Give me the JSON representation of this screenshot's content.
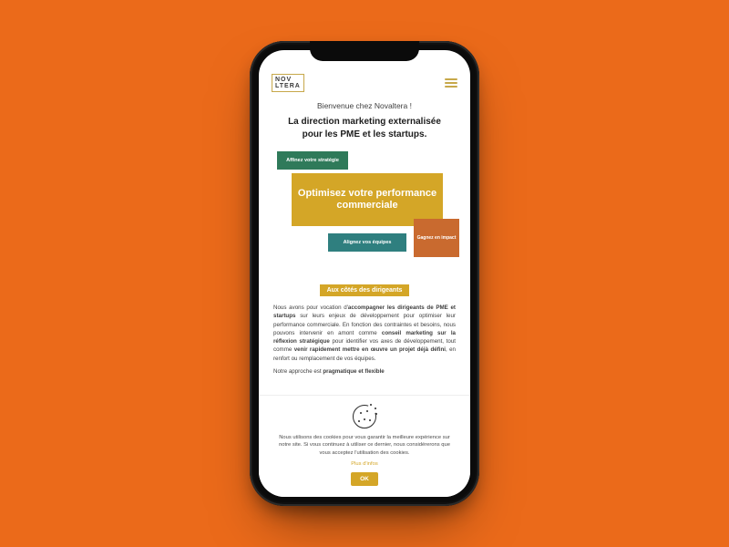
{
  "header": {
    "logo_line1": "NOV",
    "logo_line2": "LTERA"
  },
  "hero": {
    "welcome": "Bienvenue chez Novaltera !",
    "headline_l1": "La direction marketing externalisée",
    "headline_l2": "pour les PME et les startups."
  },
  "boxes": {
    "green": "Affinez votre stratégie",
    "yellow_l1": "Optimisez votre performance",
    "yellow_l2": "commerciale",
    "orange": "Gagnez en impact",
    "teal": "Alignez vos équipes"
  },
  "chip": "Aux côtés des dirigeants",
  "para1": {
    "t1": "Nous avons pour vocation d'",
    "b1": "accompagner les dirigeants de PME et startups",
    "t2": " sur leurs enjeux de développement pour optimiser leur performance commerciale. En fonction des contraintes et besoins, nous pouvons intervenir en amont comme ",
    "b2": "conseil marketing sur la réflexion stratégique",
    "t3": " pour identifier vos axes de développement, tout comme ",
    "b3": "venir rapidement mettre en œuvre un projet déjà défini",
    "t4": ", en renfort ou remplacement de vos équipes."
  },
  "para2": {
    "t1": "Notre approche est ",
    "b1": "pragmatique et flexible"
  },
  "cookie": {
    "text": "Nous utilisons des cookies pour vous garantir la meilleure expérience sur notre site. Si vous continuez à utiliser ce dernier, nous considérerons que vous acceptez l'utilisation des cookies.",
    "more": "Plus d'infos",
    "ok": "OK"
  }
}
